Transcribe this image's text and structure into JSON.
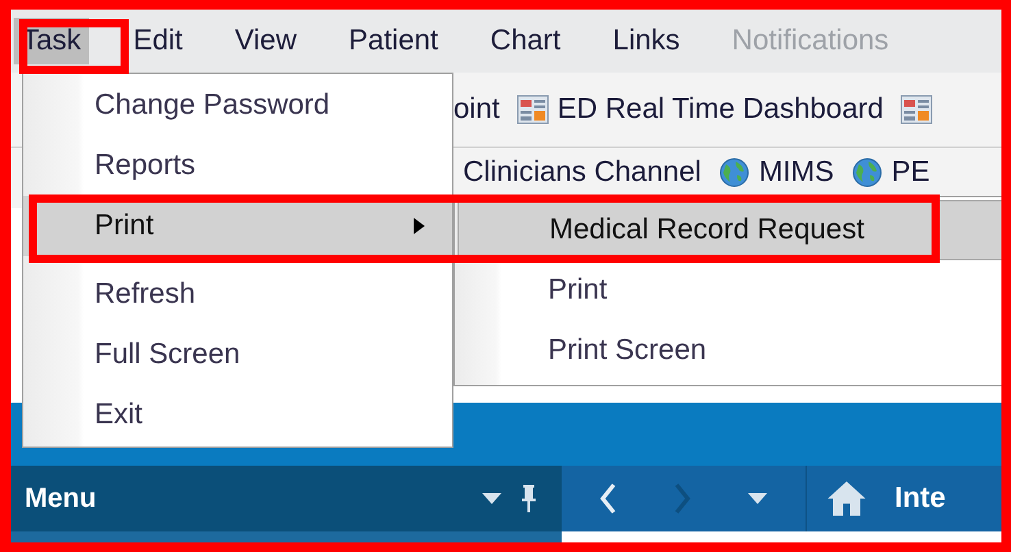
{
  "menu_bar": [
    {
      "label": "Task",
      "selected": true,
      "disabled": false
    },
    {
      "label": "Edit",
      "selected": false,
      "disabled": false
    },
    {
      "label": "View",
      "selected": false,
      "disabled": false
    },
    {
      "label": "Patient",
      "selected": false,
      "disabled": false
    },
    {
      "label": "Chart",
      "selected": false,
      "disabled": false
    },
    {
      "label": "Links",
      "selected": false,
      "disabled": false
    },
    {
      "label": "Notifications",
      "selected": false,
      "disabled": true
    }
  ],
  "toolbar_rows": [
    {
      "items": [
        {
          "kind": "link",
          "label": "oint"
        },
        {
          "kind": "dashboard",
          "label": "ED Real Time Dashboard"
        },
        {
          "kind": "dashboard"
        }
      ]
    },
    {
      "items": [
        {
          "kind": "link",
          "label": "Clinicians Channel"
        },
        {
          "kind": "web",
          "label": "MIMS"
        },
        {
          "kind": "web",
          "label": "PE"
        }
      ]
    }
  ],
  "task_menu": {
    "items": [
      {
        "label": "Change Password",
        "selected": false,
        "submenu": false
      },
      {
        "label": "Reports",
        "selected": false,
        "submenu": false
      },
      {
        "label": "Print",
        "selected": true,
        "submenu": true
      },
      {
        "label": "Refresh",
        "selected": false,
        "submenu": false
      },
      {
        "label": "Full Screen",
        "selected": false,
        "submenu": false
      },
      {
        "label": "Exit",
        "selected": false,
        "submenu": false
      }
    ]
  },
  "print_submenu": {
    "items": [
      {
        "label": "Medical Record Request",
        "selected": true
      },
      {
        "label": "Print",
        "selected": false
      },
      {
        "label": "Print Screen",
        "selected": false
      }
    ]
  },
  "menu_panel": {
    "title": "Menu"
  },
  "nav_bar": {
    "back_disabled": false,
    "forward_disabled": true,
    "title": "Inte"
  }
}
